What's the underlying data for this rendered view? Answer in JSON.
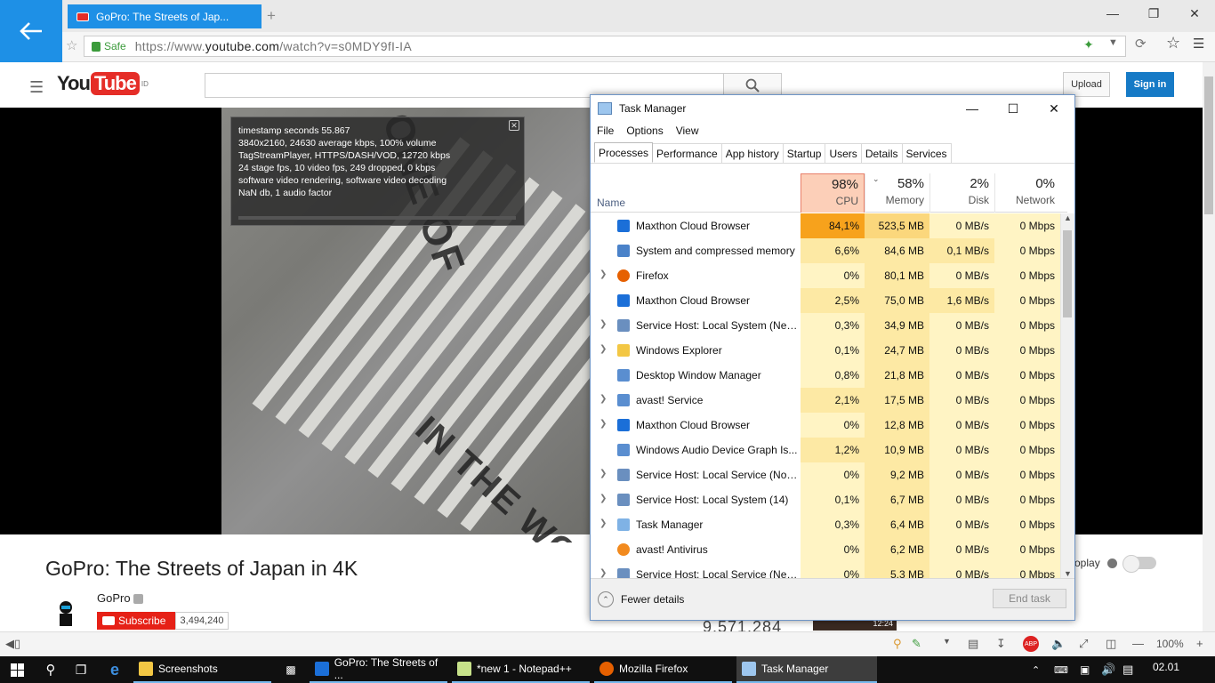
{
  "browser": {
    "tab_title": "GoPro: The Streets of Jap...",
    "new_tab_symbol": "+",
    "safe_label": "Safe",
    "url_prefix": "https://www.",
    "url_host": "youtube.com",
    "url_path": "/watch?v=s0MDY9fI-IA",
    "zoom": "100%",
    "colors": {
      "accent": "#1e90e6",
      "safe": "#3b9b3b"
    }
  },
  "youtube": {
    "logo_you": "You",
    "logo_tube": "Tube",
    "logo_region": "ID",
    "upload_label": "Upload",
    "signin_label": "Sign in",
    "stats_overlay": [
      "timestamp seconds 55.867",
      "3840x2160, 24630 average kbps, 100% volume",
      "TagStreamPlayer, HTTPS/DASH/VOD, 12720 kbps",
      "24 stage fps, 10 video fps, 249 dropped, 0 kbps",
      "software video rendering, software video decoding",
      "NaN db, 1 audio factor"
    ],
    "video_title": "GoPro: The Streets of Japan in 4K",
    "channel_name": "GoPro",
    "subscribe_label": "Subscribe",
    "subscriber_count": "3,494,240",
    "view_count": "9,571,284",
    "autoplay_label": "oplay",
    "thumb_duration": "12:24",
    "video_overlay_text_1": "ONE OF",
    "video_overlay_text_2": "IN THE WOR",
    "colors": {
      "red": "#e52d27",
      "signin": "#167ac6"
    }
  },
  "task_manager": {
    "title": "Task Manager",
    "menu": [
      "File",
      "Options",
      "View"
    ],
    "tabs": [
      "Processes",
      "Performance",
      "App history",
      "Startup",
      "Users",
      "Details",
      "Services"
    ],
    "selected_tab": "Processes",
    "columns": {
      "name": "Name",
      "cpu": {
        "pct": "98%",
        "label": "CPU"
      },
      "memory": {
        "pct": "58%",
        "label": "Memory"
      },
      "disk": {
        "pct": "2%",
        "label": "Disk"
      },
      "network": {
        "pct": "0%",
        "label": "Network"
      }
    },
    "processes": [
      {
        "name": "Maxthon Cloud Browser",
        "expand": false,
        "icon": "maxthon-icon",
        "cpu": "84,1%",
        "mem": "523,5 MB",
        "disk": "0 MB/s",
        "net": "0 Mbps"
      },
      {
        "name": "System and compressed memory",
        "expand": false,
        "icon": "system-icon",
        "cpu": "6,6%",
        "mem": "84,6 MB",
        "disk": "0,1 MB/s",
        "net": "0 Mbps"
      },
      {
        "name": "Firefox",
        "expand": true,
        "icon": "firefox-icon",
        "cpu": "0%",
        "mem": "80,1 MB",
        "disk": "0 MB/s",
        "net": "0 Mbps"
      },
      {
        "name": "Maxthon Cloud Browser",
        "expand": false,
        "icon": "maxthon-icon",
        "cpu": "2,5%",
        "mem": "75,0 MB",
        "disk": "1,6 MB/s",
        "net": "0 Mbps"
      },
      {
        "name": "Service Host: Local System (Net...",
        "expand": true,
        "icon": "gear-icon",
        "cpu": "0,3%",
        "mem": "34,9 MB",
        "disk": "0 MB/s",
        "net": "0 Mbps"
      },
      {
        "name": "Windows Explorer",
        "expand": true,
        "icon": "folder-icon",
        "cpu": "0,1%",
        "mem": "24,7 MB",
        "disk": "0 MB/s",
        "net": "0 Mbps"
      },
      {
        "name": "Desktop Window Manager",
        "expand": false,
        "icon": "window-icon",
        "cpu": "0,8%",
        "mem": "21,8 MB",
        "disk": "0 MB/s",
        "net": "0 Mbps"
      },
      {
        "name": "avast! Service",
        "expand": true,
        "icon": "window-icon",
        "cpu": "2,1%",
        "mem": "17,5 MB",
        "disk": "0 MB/s",
        "net": "0 Mbps"
      },
      {
        "name": "Maxthon Cloud Browser",
        "expand": true,
        "icon": "maxthon-icon",
        "cpu": "0%",
        "mem": "12,8 MB",
        "disk": "0 MB/s",
        "net": "0 Mbps"
      },
      {
        "name": "Windows Audio Device Graph Is...",
        "expand": false,
        "icon": "window-icon",
        "cpu": "1,2%",
        "mem": "10,9 MB",
        "disk": "0 MB/s",
        "net": "0 Mbps"
      },
      {
        "name": "Service Host: Local Service (No ...",
        "expand": true,
        "icon": "gear-icon",
        "cpu": "0%",
        "mem": "9,2 MB",
        "disk": "0 MB/s",
        "net": "0 Mbps"
      },
      {
        "name": "Service Host: Local System (14)",
        "expand": true,
        "icon": "gear-icon",
        "cpu": "0,1%",
        "mem": "6,7 MB",
        "disk": "0 MB/s",
        "net": "0 Mbps"
      },
      {
        "name": "Task Manager",
        "expand": true,
        "icon": "taskmgr-icon",
        "cpu": "0,3%",
        "mem": "6,4 MB",
        "disk": "0 MB/s",
        "net": "0 Mbps"
      },
      {
        "name": "avast! Antivirus",
        "expand": false,
        "icon": "avast-icon",
        "cpu": "0%",
        "mem": "6,2 MB",
        "disk": "0 MB/s",
        "net": "0 Mbps"
      },
      {
        "name": "Service Host: Local Service (Net...",
        "expand": true,
        "icon": "gear-icon",
        "cpu": "0%",
        "mem": "5,3 MB",
        "disk": "0 MB/s",
        "net": "0 Mbps"
      }
    ],
    "fewer_details_label": "Fewer details",
    "end_task_label": "End task",
    "colors": {
      "cpu_hot": "#f7a21c",
      "mem_hot": "#fbd77c",
      "heat_light": "#fff4c4",
      "heat_mid": "#fde9a4",
      "cpu_header": "#fccfb8"
    }
  },
  "taskbar": {
    "items": [
      {
        "label": "Screenshots",
        "icon": "folder-icon"
      },
      {
        "label": "GoPro: The Streets of ...",
        "icon": "maxthon-icon"
      },
      {
        "label": "*new 1 - Notepad++",
        "icon": "notepad-icon"
      },
      {
        "label": "Mozilla Firefox",
        "icon": "firefox-icon"
      },
      {
        "label": "Task Manager",
        "icon": "taskmgr-icon"
      }
    ],
    "clock": "02.01"
  }
}
